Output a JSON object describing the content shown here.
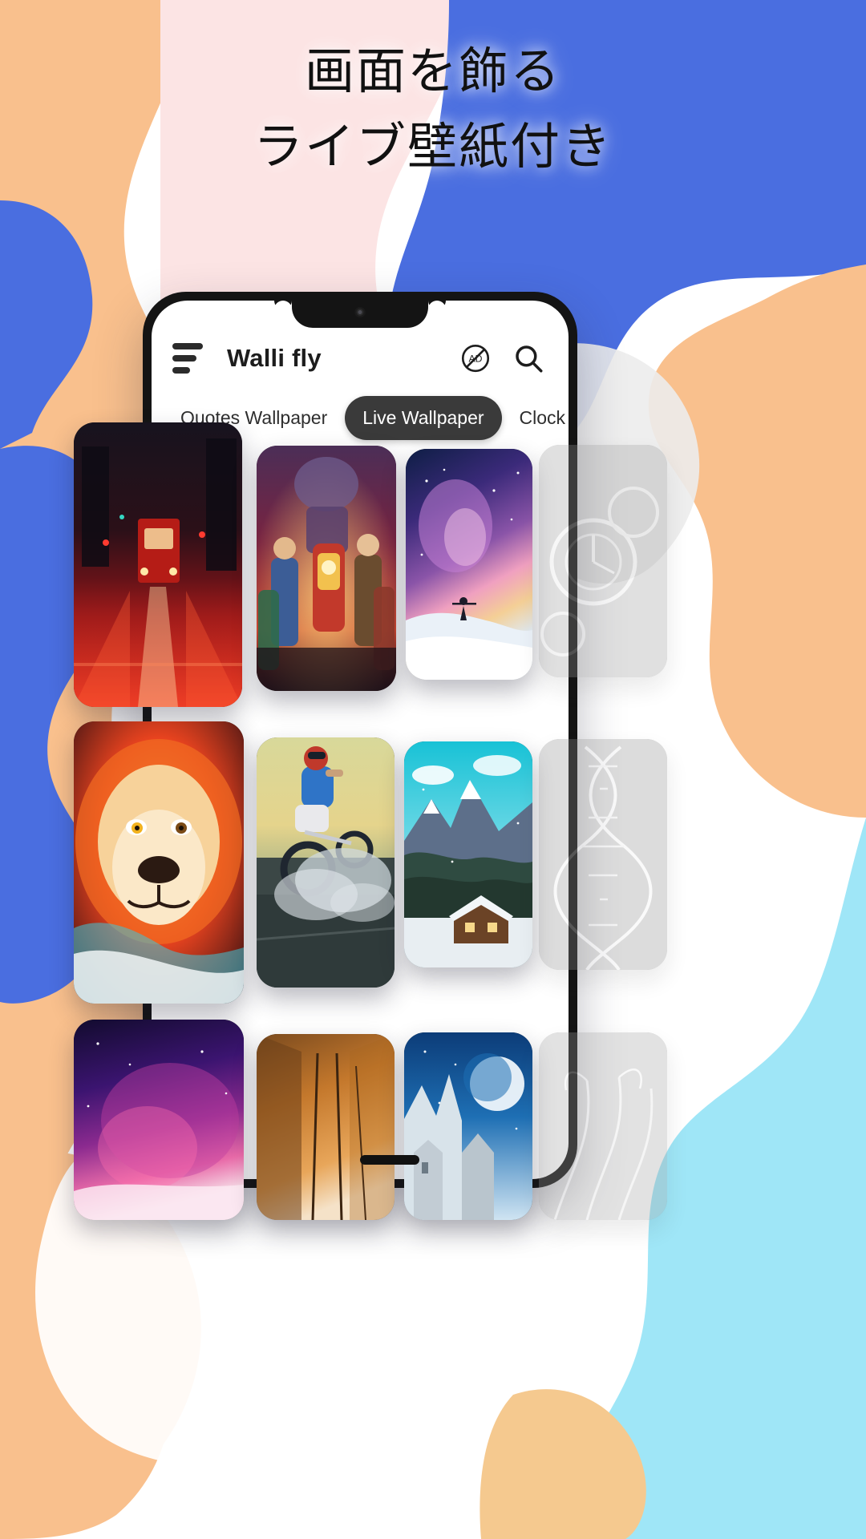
{
  "promo": {
    "headline_lines": [
      "画面を飾る",
      "ライブ壁紙付き"
    ],
    "background_colors": {
      "white": "#ffffff",
      "peach": "#f9c08d",
      "blush": "#fce4e4",
      "royal_blue": "#4a6ee0",
      "sky_blue": "#9fe6f7",
      "light_gray": "#e8e8e8"
    }
  },
  "phone": {
    "appbar": {
      "menu_icon": "hamburger-menu-icon",
      "title": "Walli fly",
      "no_ads_icon": "no-ads-icon",
      "search_icon": "search-icon"
    },
    "tabs": [
      {
        "label": "Quotes Wallpaper",
        "active": false
      },
      {
        "label": "Live Wallpaper",
        "active": true
      },
      {
        "label": "Clock Wallpaper",
        "active": false
      }
    ],
    "tab_active_bg": "#3a3a3a",
    "home_indicator": true
  },
  "wallpapers": [
    {
      "name": "neon-city-tram",
      "alt": "Red neon city street with tram at night"
    },
    {
      "name": "superheroes-poster",
      "alt": "Superhero team movie poster"
    },
    {
      "name": "galaxy-snow-hiker",
      "alt": "Hiker under a colorful galaxy sky on snow"
    },
    {
      "name": "clock-gears-grayscale",
      "alt": "Vintage clock gears wallpaper"
    },
    {
      "name": "colorful-lion",
      "alt": "Vivid painted lion portrait"
    },
    {
      "name": "stunt-biker-smoke",
      "alt": "Stunt rider doing a burnout with smoke"
    },
    {
      "name": "snow-mountain-cabin",
      "alt": "Snowy mountain with wooden cabin"
    },
    {
      "name": "dna-helix-grayscale",
      "alt": "Glowing DNA double helix"
    },
    {
      "name": "purple-nebula-tree",
      "alt": "Purple nebula with glowing tree"
    },
    {
      "name": "warm-corridor",
      "alt": "Warm orange interior corridor"
    },
    {
      "name": "moonlit-ruins",
      "alt": "Moonlit ruins under a starry blue sky"
    },
    {
      "name": "green-abstract-plant",
      "alt": "Green abstract plant light trails"
    }
  ]
}
